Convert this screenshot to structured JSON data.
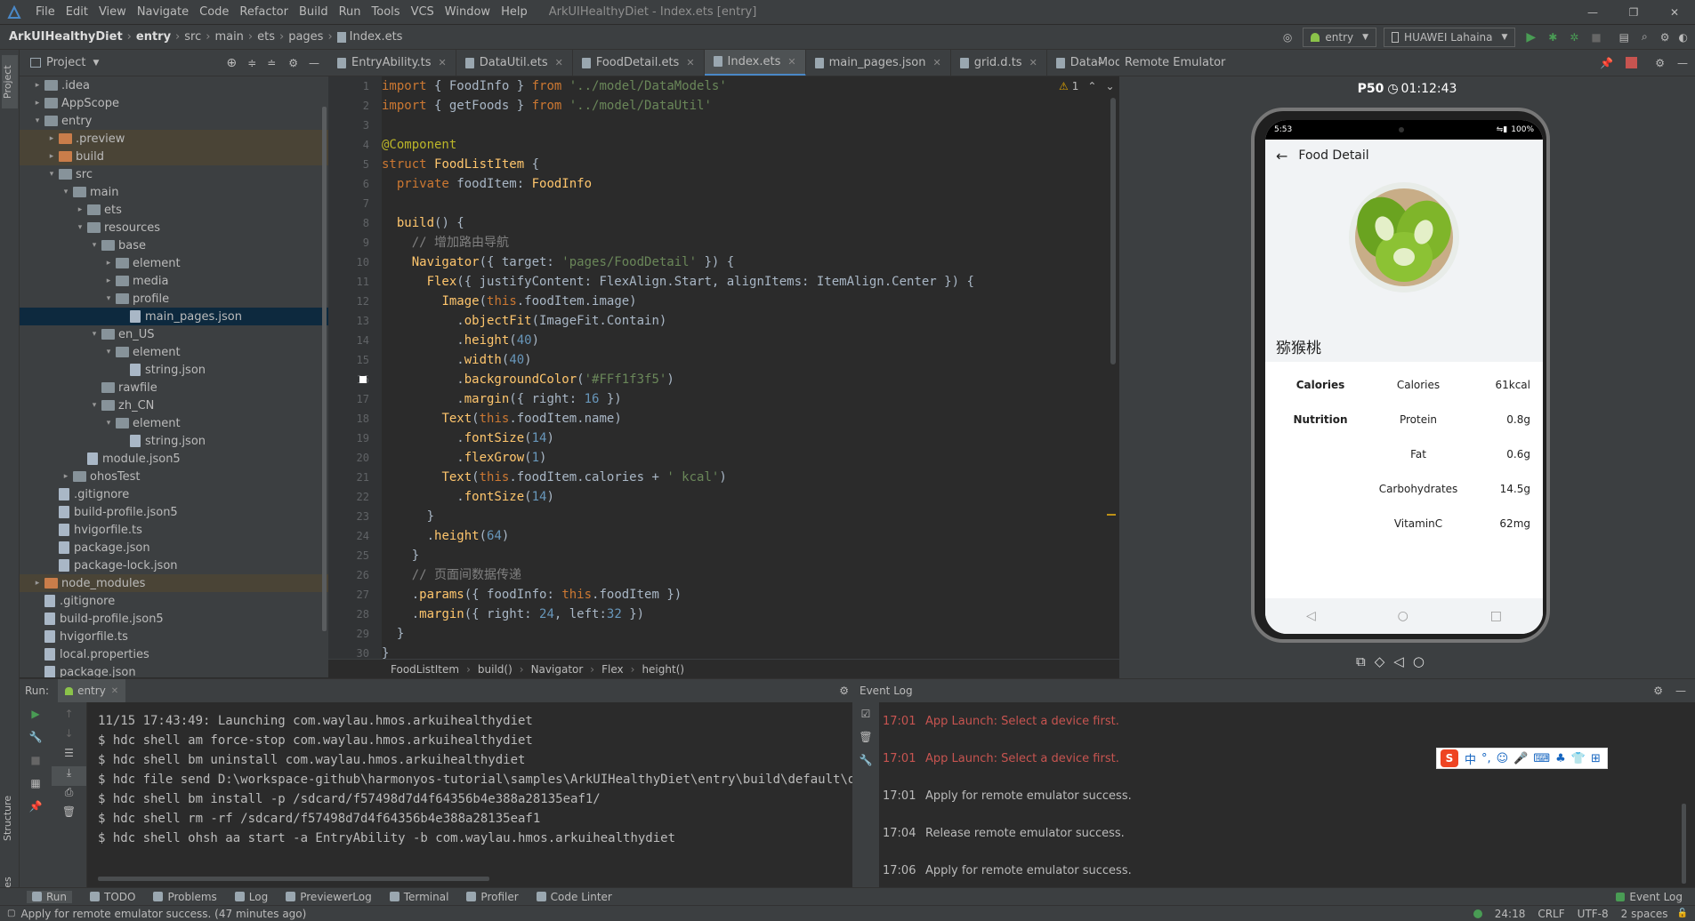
{
  "menu": {
    "items": [
      "File",
      "Edit",
      "View",
      "Navigate",
      "Code",
      "Refactor",
      "Build",
      "Run",
      "Tools",
      "VCS",
      "Window",
      "Help"
    ],
    "title": "ArkUIHealthyDiet - Index.ets [entry]"
  },
  "nav": {
    "crumbs": [
      "ArkUIHealthyDiet",
      "entry",
      "src",
      "main",
      "ets",
      "pages",
      "Index.ets"
    ],
    "run_config": "entry",
    "device": "HUAWEI Lahaina"
  },
  "project": {
    "label": "Project",
    "side_tabs": [
      "Project",
      "Structure",
      "Favorites"
    ]
  },
  "tree": [
    {
      "label": ".idea",
      "depth": 1,
      "type": "folder",
      "arrow": "closed"
    },
    {
      "label": "AppScope",
      "depth": 1,
      "type": "folder",
      "arrow": "closed"
    },
    {
      "label": "entry",
      "depth": 1,
      "type": "folder",
      "arrow": "open",
      "bold": true
    },
    {
      "label": ".preview",
      "depth": 2,
      "type": "folder-orange",
      "arrow": "closed",
      "hl": true
    },
    {
      "label": "build",
      "depth": 2,
      "type": "folder-orange",
      "arrow": "closed",
      "hl": true
    },
    {
      "label": "src",
      "depth": 2,
      "type": "folder",
      "arrow": "open"
    },
    {
      "label": "main",
      "depth": 3,
      "type": "folder",
      "arrow": "open"
    },
    {
      "label": "ets",
      "depth": 4,
      "type": "folder",
      "arrow": "closed"
    },
    {
      "label": "resources",
      "depth": 4,
      "type": "folder",
      "arrow": "open"
    },
    {
      "label": "base",
      "depth": 5,
      "type": "folder",
      "arrow": "open"
    },
    {
      "label": "element",
      "depth": 6,
      "type": "folder",
      "arrow": "closed"
    },
    {
      "label": "media",
      "depth": 6,
      "type": "folder",
      "arrow": "closed"
    },
    {
      "label": "profile",
      "depth": 6,
      "type": "folder",
      "arrow": "open"
    },
    {
      "label": "main_pages.json",
      "depth": 7,
      "type": "file",
      "arrow": "none",
      "sel": true
    },
    {
      "label": "en_US",
      "depth": 5,
      "type": "folder",
      "arrow": "open"
    },
    {
      "label": "element",
      "depth": 6,
      "type": "folder",
      "arrow": "open"
    },
    {
      "label": "string.json",
      "depth": 7,
      "type": "file",
      "arrow": "none"
    },
    {
      "label": "rawfile",
      "depth": 5,
      "type": "folder",
      "arrow": "none"
    },
    {
      "label": "zh_CN",
      "depth": 5,
      "type": "folder",
      "arrow": "open"
    },
    {
      "label": "element",
      "depth": 6,
      "type": "folder",
      "arrow": "open"
    },
    {
      "label": "string.json",
      "depth": 7,
      "type": "file",
      "arrow": "none"
    },
    {
      "label": "module.json5",
      "depth": 4,
      "type": "file",
      "arrow": "none"
    },
    {
      "label": "ohosTest",
      "depth": 3,
      "type": "folder",
      "arrow": "closed"
    },
    {
      "label": ".gitignore",
      "depth": 2,
      "type": "file",
      "arrow": "none"
    },
    {
      "label": "build-profile.json5",
      "depth": 2,
      "type": "file",
      "arrow": "none"
    },
    {
      "label": "hvigorfile.ts",
      "depth": 2,
      "type": "file",
      "arrow": "none"
    },
    {
      "label": "package.json",
      "depth": 2,
      "type": "file",
      "arrow": "none"
    },
    {
      "label": "package-lock.json",
      "depth": 2,
      "type": "file",
      "arrow": "none"
    },
    {
      "label": "node_modules",
      "depth": 1,
      "type": "folder-orange",
      "arrow": "closed",
      "hl": true
    },
    {
      "label": ".gitignore",
      "depth": 1,
      "type": "file",
      "arrow": "none"
    },
    {
      "label": "build-profile.json5",
      "depth": 1,
      "type": "file",
      "arrow": "none"
    },
    {
      "label": "hvigorfile.ts",
      "depth": 1,
      "type": "file",
      "arrow": "none"
    },
    {
      "label": "local.properties",
      "depth": 1,
      "type": "file",
      "arrow": "none"
    },
    {
      "label": "package.json",
      "depth": 1,
      "type": "file",
      "arrow": "none"
    }
  ],
  "tabs": [
    {
      "label": "EntryAbility.ts",
      "active": false
    },
    {
      "label": "DataUtil.ets",
      "active": false
    },
    {
      "label": "FoodDetail.ets",
      "active": false
    },
    {
      "label": "Index.ets",
      "active": true
    },
    {
      "label": "main_pages.json",
      "active": false
    },
    {
      "label": "grid.d.ts",
      "active": false
    },
    {
      "label": "DataModels.ets",
      "active": false
    }
  ],
  "editor": {
    "warning_count": "1",
    "lines": [
      [
        [
          "k",
          "import"
        ],
        [
          "t",
          " { FoodInfo } "
        ],
        [
          "k",
          "from"
        ],
        [
          "t",
          " "
        ],
        [
          "s",
          "'../model/DataModels'"
        ]
      ],
      [
        [
          "k",
          "import"
        ],
        [
          "t",
          " { getFoods } "
        ],
        [
          "k",
          "from"
        ],
        [
          "t",
          " "
        ],
        [
          "s",
          "'../model/DataUtil'"
        ]
      ],
      [],
      [
        [
          "a",
          "@Component"
        ]
      ],
      [
        [
          "k",
          "struct"
        ],
        [
          "t",
          " "
        ],
        [
          "f",
          "FoodListItem"
        ],
        [
          "t",
          " {"
        ]
      ],
      [
        [
          "t",
          "  "
        ],
        [
          "k",
          "private"
        ],
        [
          "t",
          " foodItem: "
        ],
        [
          "f",
          "FoodInfo"
        ]
      ],
      [],
      [
        [
          "t",
          "  "
        ],
        [
          "f",
          "build"
        ],
        [
          "t",
          "() {"
        ]
      ],
      [
        [
          "t",
          "    "
        ],
        [
          "c",
          "// 增加路由导航"
        ]
      ],
      [
        [
          "t",
          "    "
        ],
        [
          "f",
          "Navigator"
        ],
        [
          "t",
          "({ target: "
        ],
        [
          "s",
          "'pages/FoodDetail'"
        ],
        [
          "t",
          " }) {"
        ]
      ],
      [
        [
          "t",
          "      "
        ],
        [
          "f",
          "Flex"
        ],
        [
          "t",
          "({ justifyContent: FlexAlign.Start, alignItems: ItemAlign.Center }) {"
        ]
      ],
      [
        [
          "t",
          "        "
        ],
        [
          "f",
          "Image"
        ],
        [
          "t",
          "("
        ],
        [
          "k",
          "this"
        ],
        [
          "t",
          ".foodItem.image)"
        ]
      ],
      [
        [
          "t",
          "          ."
        ],
        [
          "f",
          "objectFit"
        ],
        [
          "t",
          "(ImageFit.Contain)"
        ]
      ],
      [
        [
          "t",
          "          ."
        ],
        [
          "f",
          "height"
        ],
        [
          "t",
          "("
        ],
        [
          "n",
          "40"
        ],
        [
          "t",
          ")"
        ]
      ],
      [
        [
          "t",
          "          ."
        ],
        [
          "f",
          "width"
        ],
        [
          "t",
          "("
        ],
        [
          "n",
          "40"
        ],
        [
          "t",
          ")"
        ]
      ],
      [
        [
          "t",
          "          ."
        ],
        [
          "f",
          "backgroundColor"
        ],
        [
          "t",
          "("
        ],
        [
          "s",
          "'#FFf1f3f5'"
        ],
        [
          "t",
          ")"
        ]
      ],
      [
        [
          "t",
          "          ."
        ],
        [
          "f",
          "margin"
        ],
        [
          "t",
          "({ right: "
        ],
        [
          "n",
          "16"
        ],
        [
          "t",
          " })"
        ]
      ],
      [
        [
          "t",
          "        "
        ],
        [
          "f",
          "Text"
        ],
        [
          "t",
          "("
        ],
        [
          "k",
          "this"
        ],
        [
          "t",
          ".foodItem.name)"
        ]
      ],
      [
        [
          "t",
          "          ."
        ],
        [
          "f",
          "fontSize"
        ],
        [
          "t",
          "("
        ],
        [
          "n",
          "14"
        ],
        [
          "t",
          ")"
        ]
      ],
      [
        [
          "t",
          "          ."
        ],
        [
          "f",
          "flexGrow"
        ],
        [
          "t",
          "("
        ],
        [
          "n",
          "1"
        ],
        [
          "t",
          ")"
        ]
      ],
      [
        [
          "t",
          "        "
        ],
        [
          "f",
          "Text"
        ],
        [
          "t",
          "("
        ],
        [
          "k",
          "this"
        ],
        [
          "t",
          ".foodItem.calories + "
        ],
        [
          "s",
          "' kcal'"
        ],
        [
          "t",
          ")"
        ]
      ],
      [
        [
          "t",
          "          ."
        ],
        [
          "f",
          "fontSize"
        ],
        [
          "t",
          "("
        ],
        [
          "n",
          "14"
        ],
        [
          "t",
          ")"
        ]
      ],
      [
        [
          "t",
          "      }"
        ]
      ],
      [
        [
          "t",
          "      ."
        ],
        [
          "f",
          "height"
        ],
        [
          "t",
          "("
        ],
        [
          "n",
          "64"
        ],
        [
          "t",
          ")"
        ]
      ],
      [
        [
          "t",
          "    }"
        ]
      ],
      [
        [
          "t",
          "    "
        ],
        [
          "c",
          "// 页面间数据传递"
        ]
      ],
      [
        [
          "t",
          "    ."
        ],
        [
          "f",
          "params"
        ],
        [
          "t",
          "({ foodInfo: "
        ],
        [
          "k",
          "this"
        ],
        [
          "t",
          ".foodItem })"
        ]
      ],
      [
        [
          "t",
          "    ."
        ],
        [
          "f",
          "margin"
        ],
        [
          "t",
          "({ right: "
        ],
        [
          "n",
          "24"
        ],
        [
          "t",
          ", left:"
        ],
        [
          "n",
          "32"
        ],
        [
          "t",
          " })"
        ]
      ],
      [
        [
          "t",
          "  }"
        ]
      ],
      [
        [
          "t",
          "}"
        ]
      ]
    ]
  },
  "code_breadcrumb": [
    "FoodListItem",
    "build()",
    "Navigator",
    "Flex",
    "height()"
  ],
  "emulator": {
    "header": "Remote Emulator",
    "device": "P50",
    "timer": "01:12:43",
    "status_time": "5:53",
    "battery": "100%",
    "page_title": "Food Detail",
    "food_name": "猕猴桃",
    "nutrition": [
      {
        "group": "Calories",
        "name": "Calories",
        "value": "61kcal"
      },
      {
        "group": "Nutrition",
        "name": "Protein",
        "value": "0.8g"
      },
      {
        "group": "",
        "name": "Fat",
        "value": "0.6g"
      },
      {
        "group": "",
        "name": "Carbohydrates",
        "value": "14.5g"
      },
      {
        "group": "",
        "name": "VitaminC",
        "value": "62mg"
      }
    ]
  },
  "run": {
    "label": "Run:",
    "config": "entry",
    "console": [
      "11/15 17:43:49: Launching com.waylau.hmos.arkuihealthydiet",
      "$ hdc shell am force-stop com.waylau.hmos.arkuihealthydiet",
      "$ hdc shell bm uninstall com.waylau.hmos.arkuihealthydiet",
      "$ hdc file send D:\\workspace-github\\harmonyos-tutorial\\samples\\ArkUIHealthyDiet\\entry\\build\\default\\outputs\\d",
      "$ hdc shell bm install -p /sdcard/f57498d7d4f64356b4e388a28135eaf1/",
      "$ hdc shell rm -rf /sdcard/f57498d7d4f64356b4e388a28135eaf1",
      "$ hdc shell ohsh aa start -a EntryAbility -b com.waylau.hmos.arkuihealthydiet"
    ]
  },
  "eventlog": {
    "header": "Event Log",
    "entries": [
      {
        "time": "17:01",
        "msg": "App Launch: Select a device first.",
        "error": true
      },
      {
        "time": "17:01",
        "msg": "App Launch: Select a device first.",
        "error": true
      },
      {
        "time": "17:01",
        "msg": "Apply for remote emulator success.",
        "error": false
      },
      {
        "time": "17:04",
        "msg": "Release remote emulator success.",
        "error": false
      },
      {
        "time": "17:06",
        "msg": "Apply for remote emulator success.",
        "error": false
      }
    ]
  },
  "ime": {
    "logo": "S",
    "items": [
      "中",
      "°,",
      "☺",
      "🎤",
      "⌨",
      "♣",
      "👕",
      "⊞"
    ]
  },
  "bottom_tabs": [
    "Run",
    "TODO",
    "Problems",
    "Log",
    "PreviewerLog",
    "Terminal",
    "Profiler",
    "Code Linter"
  ],
  "bottom_right": "Event Log",
  "status": {
    "message": "Apply for remote emulator success. (47 minutes ago)",
    "position": "24:18",
    "line_sep": "CRLF",
    "encoding": "UTF-8",
    "indent": "2 spaces"
  },
  "colors": {
    "accent": "#4a88c7",
    "error": "#c75450",
    "run_green": "#499c54"
  }
}
